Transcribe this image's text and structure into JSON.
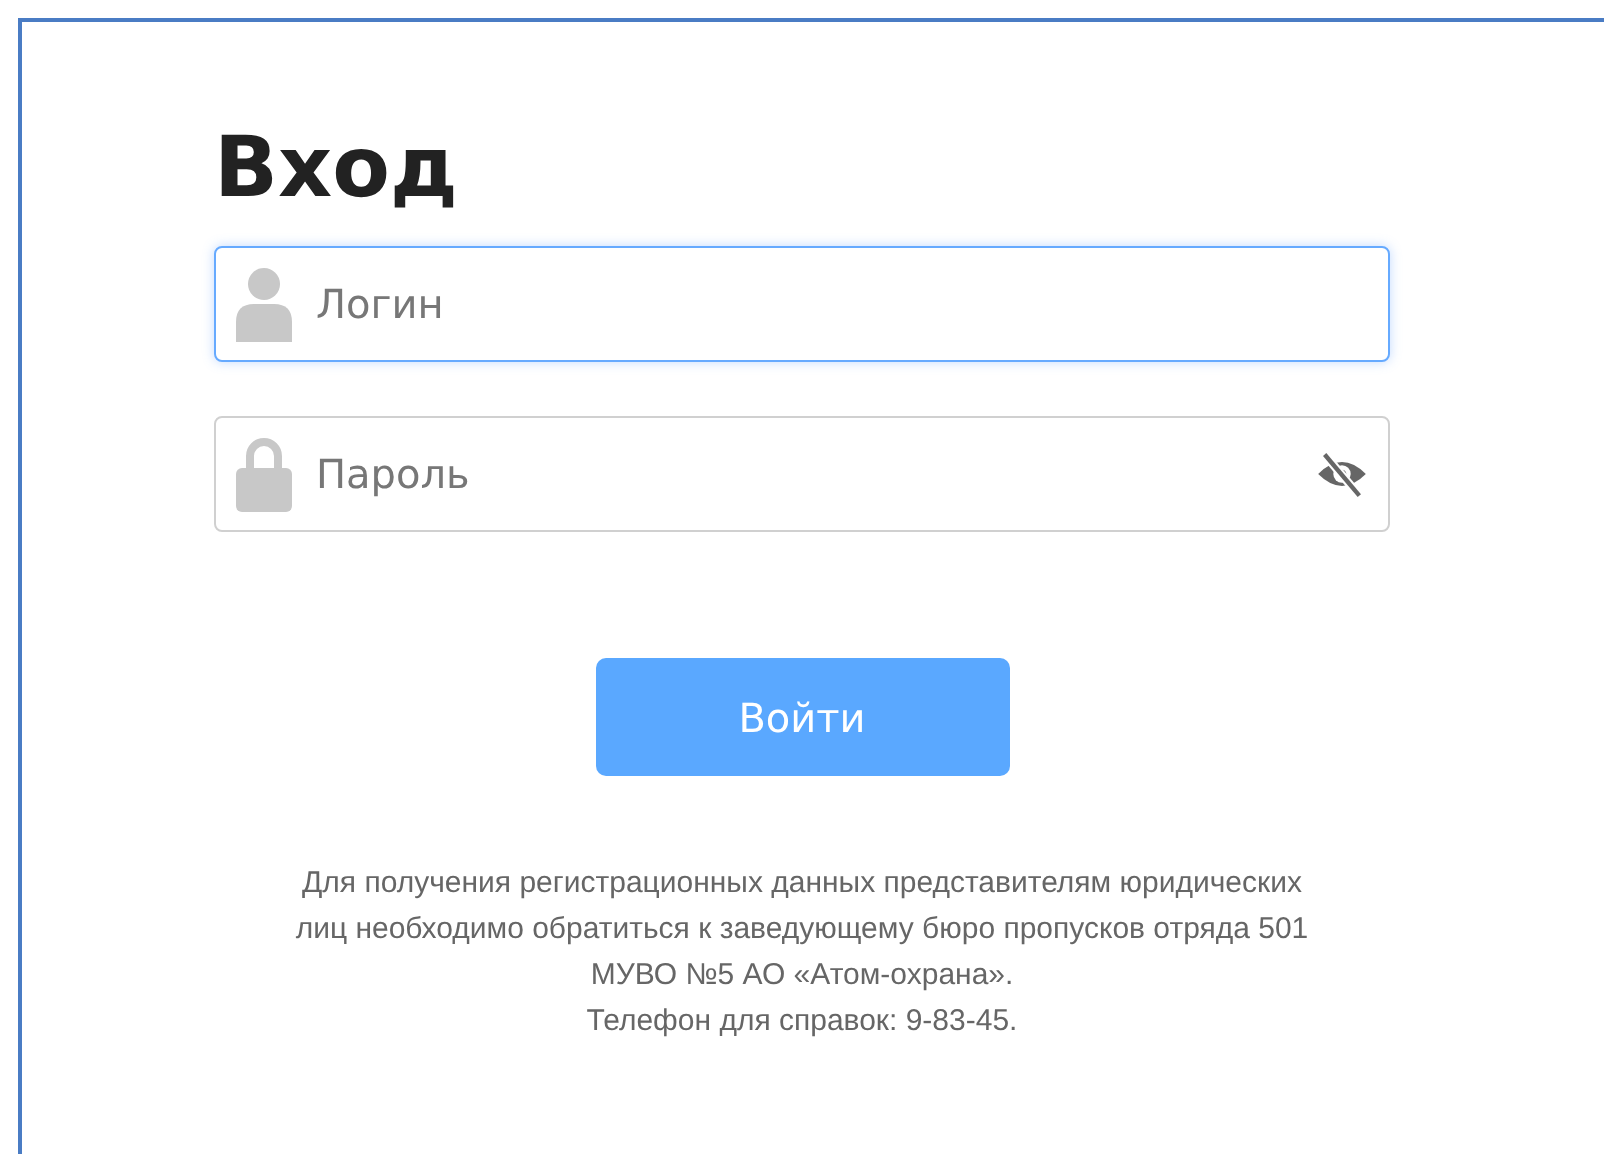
{
  "title": "Вход",
  "fields": [
    {
      "kind": "login",
      "placeholder": "Логин",
      "focused": true
    },
    {
      "kind": "password",
      "placeholder": "Пароль",
      "focused": false
    }
  ],
  "submit_button": "Войти",
  "note": "Для получения регистрационных данных представителям юридических лиц необходимо обратиться к заведующему бюро пропусков отряда 501 МУВО №5 АО «Атом-охрана».",
  "phone": "Телефон для справок: 9-83-45."
}
